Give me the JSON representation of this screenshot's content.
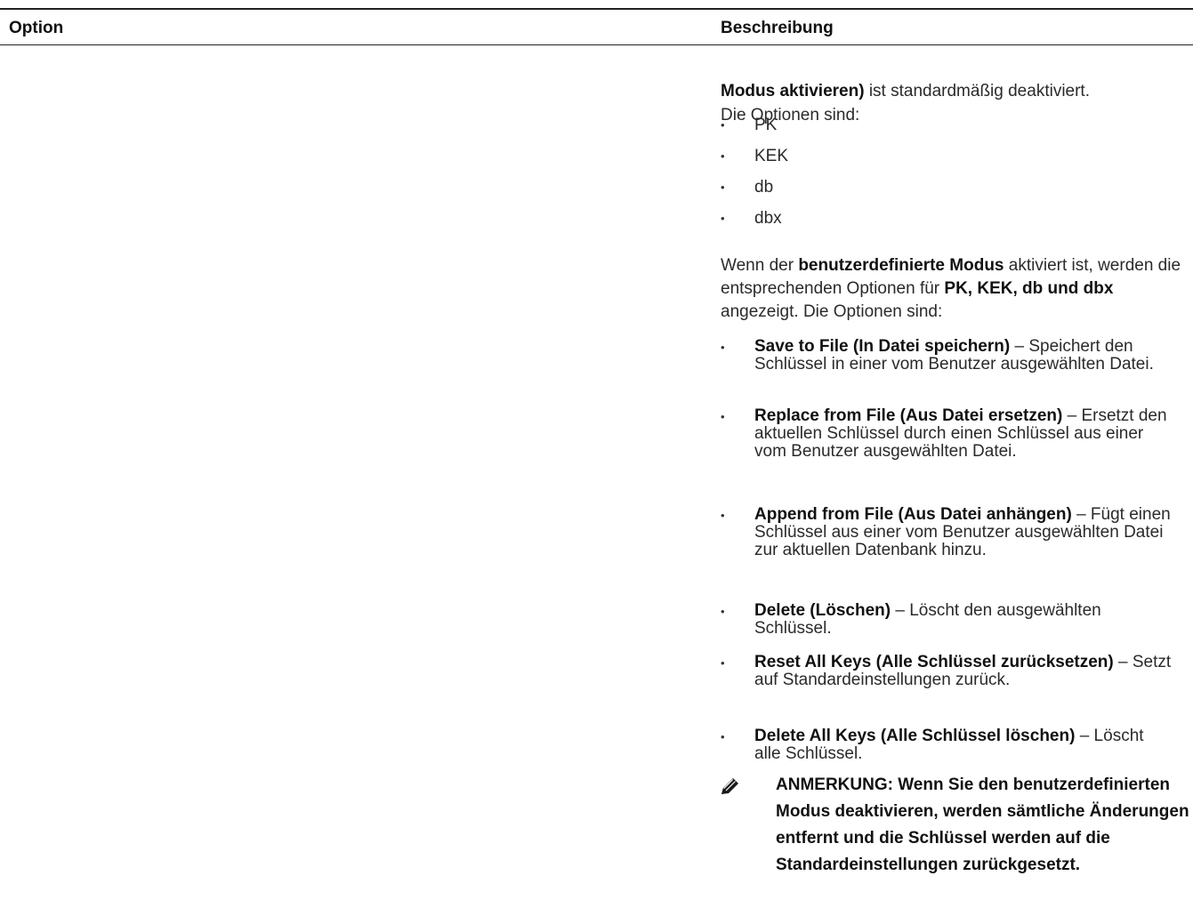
{
  "header": {
    "option": "Option",
    "description": "Beschreibung"
  },
  "description": {
    "intro_bold": "Modus aktivieren)",
    "intro_rest": " ist standardmäßig deaktiviert.",
    "options_label_1": "Die Optionen sind:",
    "key_options": [
      "PK",
      "KEK",
      "db",
      "dbx"
    ],
    "custom_p1": "Wenn der ",
    "custom_b1": "benutzerdefinierte Modus",
    "custom_p2": " aktiviert ist, werden die entsprechenden Optionen für ",
    "custom_b2": "PK, KEK, db und dbx",
    "custom_p3": " angezeigt. Die Optionen sind:",
    "actions": [
      {
        "bold": "Save to File (In Datei speichern)",
        "text": " – Speichert den Schlüssel in einer vom Benutzer ausgewählten Datei."
      },
      {
        "bold": "Replace from File (Aus Datei ersetzen)",
        "text": " – Ersetzt den aktuellen Schlüssel durch einen Schlüssel aus einer vom Benutzer ausgewählten Datei."
      },
      {
        "bold": "Append from File (Aus Datei anhängen)",
        "text": " – Fügt einen Schlüssel aus einer vom Benutzer ausgewählten Datei zur aktuellen Datenbank hinzu."
      },
      {
        "bold": "Delete (Löschen)",
        "text": " – Löscht den ausgewählten Schlüssel."
      },
      {
        "bold": "Reset All Keys (Alle Schlüssel zurücksetzen)",
        "text": " – Setzt auf Standardeinstellungen zurück."
      },
      {
        "bold": "Delete All Keys (Alle Schlüssel löschen)",
        "text": " – Löscht alle Schlüssel."
      }
    ],
    "note": "ANMERKUNG: Wenn Sie den benutzerdefinierten Modus deaktivieren, werden sämtliche Änderungen entfernt und die Schlüssel werden auf die Standardeinstellungen zurückgesetzt."
  },
  "icons": {
    "note": "pencil-icon"
  }
}
